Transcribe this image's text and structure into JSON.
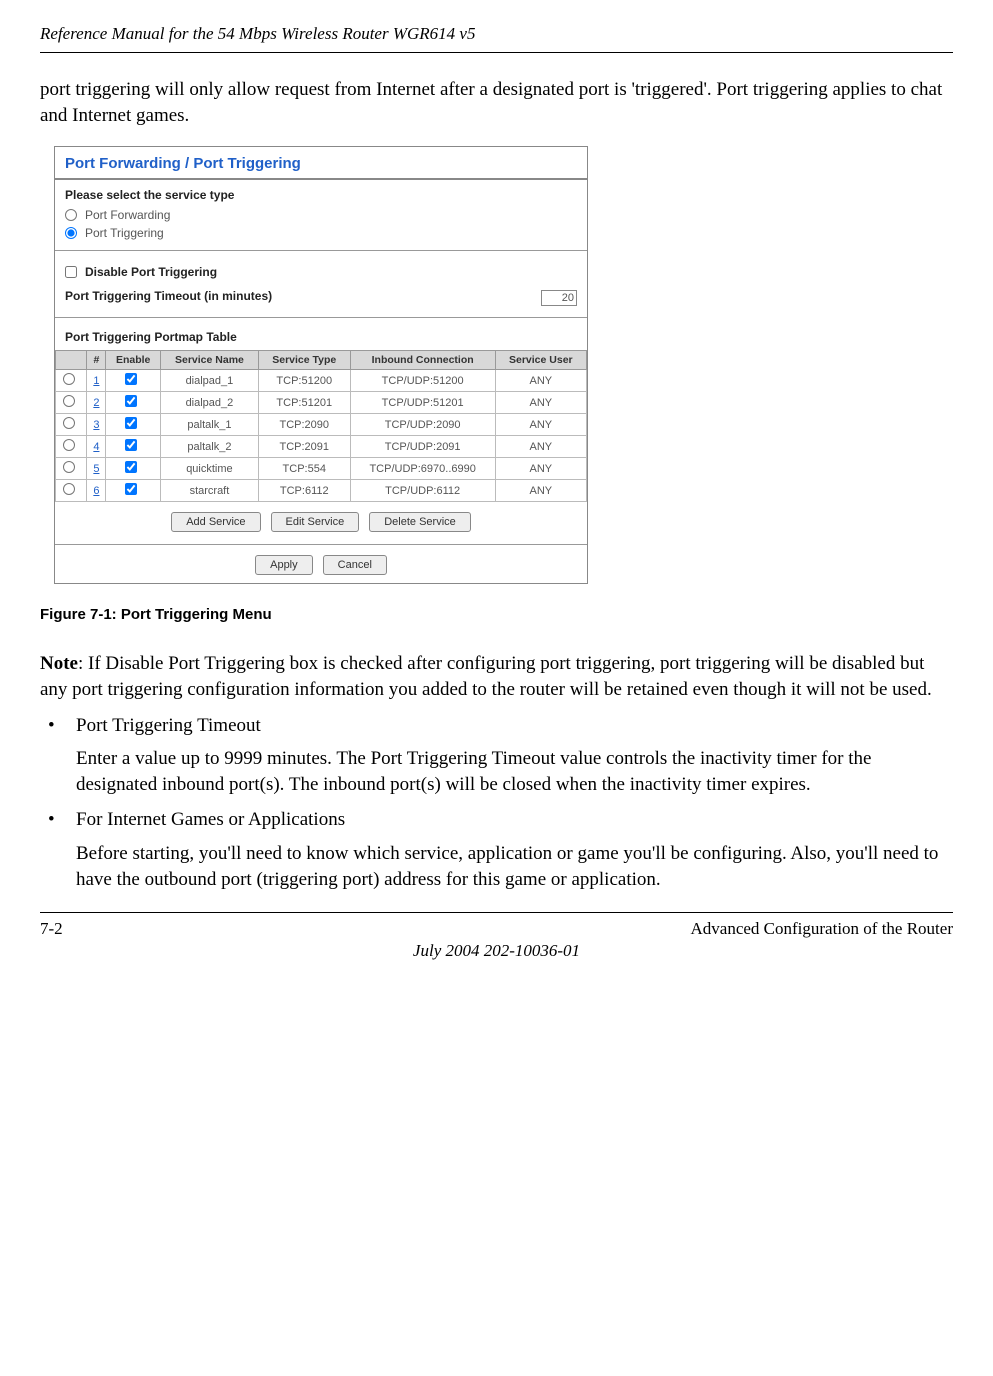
{
  "header": "Reference Manual for the 54 Mbps Wireless Router WGR614 v5",
  "intro": "port triggering will only allow request from Internet after a designated port is 'triggered'. Port triggering applies to chat and Internet games.",
  "screenshot": {
    "title": "Port Forwarding / Port Triggering",
    "selectLabel": "Please select the service type",
    "radioForwarding": "Port Forwarding",
    "radioTriggering": "Port Triggering",
    "disableLabel": "Disable Port Triggering",
    "timeoutLabel": "Port Triggering Timeout (in minutes)",
    "timeoutValue": "20",
    "portmapLabel": "Port Triggering Portmap Table",
    "headers": {
      "num": "#",
      "enable": "Enable",
      "name": "Service Name",
      "type": "Service Type",
      "inbound": "Inbound Connection",
      "user": "Service User"
    },
    "rows": [
      {
        "n": "1",
        "name": "dialpad_1",
        "type": "TCP:51200",
        "inbound": "TCP/UDP:51200",
        "user": "ANY"
      },
      {
        "n": "2",
        "name": "dialpad_2",
        "type": "TCP:51201",
        "inbound": "TCP/UDP:51201",
        "user": "ANY"
      },
      {
        "n": "3",
        "name": "paltalk_1",
        "type": "TCP:2090",
        "inbound": "TCP/UDP:2090",
        "user": "ANY"
      },
      {
        "n": "4",
        "name": "paltalk_2",
        "type": "TCP:2091",
        "inbound": "TCP/UDP:2091",
        "user": "ANY"
      },
      {
        "n": "5",
        "name": "quicktime",
        "type": "TCP:554",
        "inbound": "TCP/UDP:6970..6990",
        "user": "ANY"
      },
      {
        "n": "6",
        "name": "starcraft",
        "type": "TCP:6112",
        "inbound": "TCP/UDP:6112",
        "user": "ANY"
      }
    ],
    "buttons": {
      "add": "Add Service",
      "edit": "Edit Service",
      "del": "Delete Service",
      "apply": "Apply",
      "cancel": "Cancel"
    }
  },
  "figCaption": "Figure 7-1:  Port Triggering Menu",
  "noteLabel": "Note",
  "noteText": ": If Disable Port Triggering box is checked after configuring port triggering, port triggering will be disabled but any port triggering configuration information you added to the router will be retained even though it will not be used.",
  "bullets": [
    {
      "title": "Port Triggering Timeout",
      "body": "Enter a value up to 9999 minutes. The Port Triggering Timeout value controls the inactivity timer for the designated inbound port(s). The inbound port(s) will be closed when the inactivity timer expires."
    },
    {
      "title": "For Internet Games or Applications",
      "body": "Before starting, you'll need to know which service, application or game you'll be configuring. Also, you'll need to have the outbound port (triggering port) address for this game or application."
    }
  ],
  "footer": {
    "left": "7-2",
    "right": "Advanced Configuration of the Router",
    "center": "July 2004 202-10036-01"
  }
}
